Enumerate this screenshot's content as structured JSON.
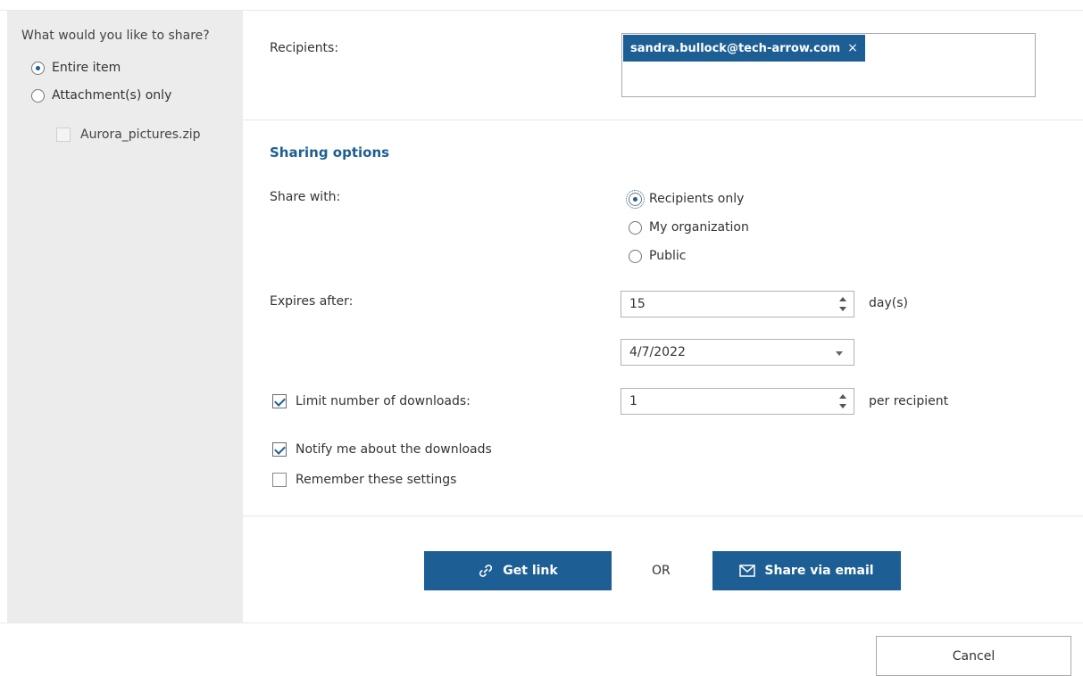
{
  "left": {
    "title": "What would you like to share?",
    "options": [
      {
        "label": "Entire item",
        "selected": true
      },
      {
        "label": "Attachment(s) only",
        "selected": false
      }
    ],
    "attachment": {
      "label": "Aurora_pictures.zip",
      "checked": false,
      "disabled": true
    }
  },
  "recipients": {
    "label": "Recipients:",
    "chips": [
      {
        "email": "sandra.bullock@tech-arrow.com",
        "remove": "×"
      }
    ]
  },
  "sharing": {
    "title": "Sharing options",
    "share_with_label": "Share with:",
    "share_with_options": [
      {
        "label": "Recipients only",
        "selected": true
      },
      {
        "label": "My organization",
        "selected": false
      },
      {
        "label": "Public",
        "selected": false
      }
    ],
    "expires_label": "Expires after:",
    "expires_value": "15",
    "expires_unit": "day(s)",
    "expires_date": "4/7/2022",
    "limit_label": "Limit number of downloads:",
    "limit_checked": true,
    "limit_value": "1",
    "limit_unit": "per recipient",
    "notify_label": "Notify me about the downloads",
    "notify_checked": true,
    "remember_label": "Remember these settings",
    "remember_checked": false
  },
  "actions": {
    "get_link": "Get link",
    "or": "OR",
    "share_email": "Share via email",
    "cancel": "Cancel"
  },
  "colors": {
    "accent": "#1d5f94",
    "panel": "#ececec"
  }
}
